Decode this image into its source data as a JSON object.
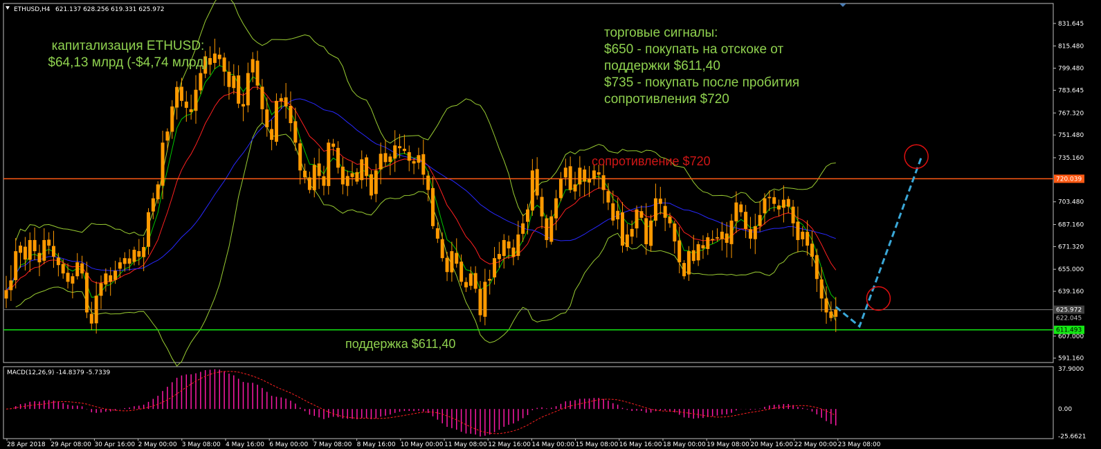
{
  "header": {
    "symbol": "ETHUSD,H4",
    "ohlc": "621.137 628.256 619.331 625.972"
  },
  "annotations": {
    "cap_line1": "капитализация ETHUSD:",
    "cap_line2": "$64,13 млрд (-$4,74 млрд)",
    "signals": [
      "торговые сигналы:",
      "$650 - покупать на отскоке от",
      "поддержки $611,40",
      "$735 - покупать после пробития",
      "сопротивления $720"
    ],
    "resistance": "сопротивление $720",
    "support": "поддержка $611,40"
  },
  "colors": {
    "candle": "#ff9900",
    "grid_frame": "#c0c0c0",
    "resistance_line": "#ff5a14",
    "support_line": "#14e614",
    "current_price_line": "#808080",
    "bollinger": "#9acd32",
    "ma_fast": "#00c800",
    "ma_mid": "#ff2020",
    "ma_slow": "#2828ff",
    "macd_hist": "#ff1aa8",
    "macd_signal": "#ff2020",
    "projection": "#3aa8d8",
    "circle": "#e01010"
  },
  "chart_data": {
    "type": "candlestick",
    "symbol": "ETHUSD",
    "timeframe": "H4",
    "ylim": [
      588,
      846
    ],
    "y_ticks": [
      831.645,
      815.48,
      799.48,
      783.645,
      767.32,
      751.48,
      735.16,
      703.48,
      687.16,
      671.32,
      655.0,
      639.16,
      607.0,
      591.16
    ],
    "x_ticks": [
      "28 Apr 2018",
      "29 Apr 08:00",
      "30 Apr 16:00",
      "2 May 00:00",
      "3 May 08:00",
      "4 May 16:00",
      "6 May 00:00",
      "7 May 08:00",
      "8 May 16:00",
      "10 May 00:00",
      "11 May 08:00",
      "12 May 16:00",
      "14 May 00:00",
      "15 May 08:00",
      "16 May 16:00",
      "18 May 00:00",
      "19 May 08:00",
      "20 May 16:00",
      "22 May 00:00",
      "23 May 08:00"
    ],
    "price_tags": [
      {
        "label": "720.039",
        "value": 720.039,
        "role": "resistance"
      },
      {
        "label": "625.972",
        "value": 625.972,
        "role": "current"
      },
      {
        "label": "622.045",
        "value": 622.045,
        "role": "secondary"
      },
      {
        "label": "611.493",
        "value": 611.493,
        "role": "support"
      }
    ],
    "close": [
      640,
      647,
      668,
      672,
      662,
      676,
      668,
      660,
      676,
      672,
      664,
      658,
      652,
      646,
      650,
      660,
      652,
      624,
      616,
      636,
      645,
      652,
      646,
      654,
      660,
      663,
      659,
      669,
      664,
      671,
      696,
      706,
      716,
      746,
      754,
      772,
      786,
      776,
      771,
      768,
      784,
      796,
      808,
      802,
      810,
      806,
      797,
      786,
      794,
      774,
      772,
      796,
      806,
      787,
      770,
      757,
      748,
      776,
      778,
      772,
      760,
      746,
      726,
      721,
      712,
      730,
      722,
      715,
      746,
      743,
      728,
      716,
      722,
      724,
      718,
      734,
      722,
      708,
      726,
      738,
      732,
      736,
      744,
      742,
      740,
      733,
      731,
      737,
      723,
      712,
      686,
      677,
      663,
      653,
      668,
      659,
      646,
      642,
      652,
      641,
      622,
      646,
      648,
      663,
      666,
      676,
      670,
      664,
      680,
      688,
      698,
      726,
      708,
      693,
      676,
      693,
      706,
      720,
      728,
      712,
      716,
      728,
      718,
      720,
      726,
      723,
      712,
      703,
      690,
      697,
      672,
      680,
      684,
      698,
      692,
      673,
      690,
      706,
      702,
      692,
      688,
      675,
      660,
      650,
      668,
      661,
      673,
      670,
      678,
      676,
      678,
      682,
      674,
      690,
      703,
      696,
      684,
      677,
      686,
      694,
      706,
      707,
      702,
      698,
      705,
      700,
      688,
      676,
      682,
      672,
      664,
      648,
      634,
      624,
      620,
      626
    ],
    "indicators": [
      {
        "name": "Bollinger Bands",
        "type": "bands"
      },
      {
        "name": "MA fast",
        "type": "line"
      },
      {
        "name": "MA mid",
        "type": "line"
      },
      {
        "name": "MA slow",
        "type": "line"
      }
    ],
    "macd": {
      "label": "MACD(12,26,9) -14.8379 -5.7339",
      "params": [
        12,
        26,
        9
      ],
      "macd_value": -14.8379,
      "signal_value": -5.7339,
      "ylim": [
        -28,
        40
      ],
      "y_ticks": [
        {
          "label": "37.9000",
          "value": 37.9
        },
        {
          "label": "0.00",
          "value": 0
        },
        {
          "label": "-25.6621",
          "value": -25.6621
        }
      ]
    },
    "projection": {
      "type": "dashed",
      "points": [
        {
          "i": 175,
          "y": 628
        },
        {
          "i": 180,
          "y": 614
        },
        {
          "i": 193,
          "y": 735
        }
      ]
    },
    "circles": [
      {
        "i": 184,
        "y": 634
      },
      {
        "i": 192,
        "y": 736
      }
    ]
  }
}
